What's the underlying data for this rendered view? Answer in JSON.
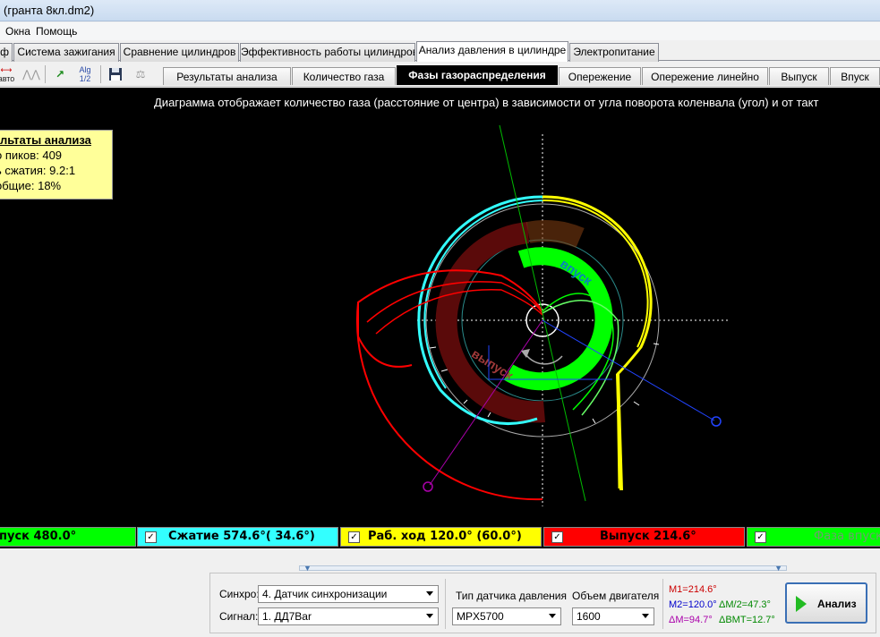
{
  "window": {
    "title": "(гранта 8кл.dm2)"
  },
  "menu": [
    "Окна",
    "Помощь"
  ],
  "main_tabs": [
    "ф",
    "Система зажигания",
    "Сравнение цилиндров",
    "Эффективность работы цилиндров",
    "Анализ давления в цилиндре",
    "Электропитание"
  ],
  "toolbar": {
    "icon_auto_label": "авто",
    "icon_alg_label": "Alg 1/2"
  },
  "sub_tabs": [
    "Результаты анализа",
    "Количество газа",
    "Фазы газораспределения",
    "Опережение",
    "Опережение линейно",
    "Выпуск",
    "Впуск"
  ],
  "plot": {
    "description": "Диаграмма отображает количество газа (расстояние от центра) в зависимости от угла поворота коленвала (угол) и от такт",
    "arc_label_intake": "впуск",
    "arc_label_exhaust": "выпуск"
  },
  "info_box": {
    "title": "льтаты анализа",
    "lines": [
      "о пиков: 409",
      "ь сжатия: 9.2:1",
      "общие: 18%"
    ]
  },
  "legend": [
    {
      "label": "пуск 480.0°",
      "color": "#00ff00",
      "text_color": "#000000",
      "checked": false
    },
    {
      "label": "Сжатие 574.6°( 34.6°)",
      "color": "#33ffff",
      "text_color": "#000000",
      "checked": true
    },
    {
      "label": "Раб. ход 120.0° (60.0°)",
      "color": "#ffff00",
      "text_color": "#000000",
      "checked": true
    },
    {
      "label": "Выпуск 214.6°",
      "color": "#ff0000",
      "text_color": "#000000",
      "checked": true
    },
    {
      "label": "Фаза впуска",
      "color": "#00ff00",
      "text_color": "#6f9f6f",
      "checked": true
    }
  ],
  "controls": {
    "sync_label": "Синхро:",
    "sync_value": "4.  Датчик синхронизации",
    "signal_label": "Сигнал:",
    "signal_value": "1.  ДД7Bar",
    "sensor_type_label": "Тип датчика давления",
    "sensor_type_value": "MPX5700",
    "engine_volume_label": "Объем двигателя",
    "engine_volume_value": "1600",
    "run_button": "Анализ"
  },
  "stats": {
    "m1": "M1=214.6°",
    "m2": "M2=120.0°",
    "dm2": "ΔM/2=47.3°",
    "dm": "ΔM=94.7°",
    "dbmt": "ΔBMT=12.7°"
  },
  "colors": {
    "intake": "#00ff00",
    "compression": "#33ffff",
    "power": "#ffff00",
    "exhaust": "#ff0000",
    "exhaust_band": "#5a0a0a"
  }
}
